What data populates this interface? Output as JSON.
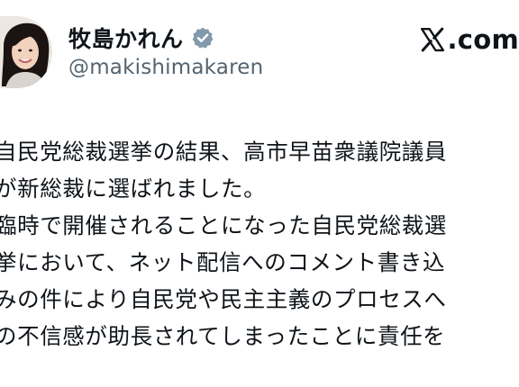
{
  "author": {
    "display_name": "牧島かれん",
    "handle": "@makishimakaren",
    "verified": true
  },
  "brand": {
    "text": ".com",
    "icon": "x-logo-icon"
  },
  "post": {
    "lines": [
      "自民党総裁選挙の結果、高市早苗衆議院議員",
      "が新総裁に選ばれました。",
      "臨時で開催されることになった自民党総裁選",
      "挙において、ネット配信へのコメント書き込",
      "みの件により自民党や民主主義のプロセスへ",
      "の不信感が助長されてしまったことに責任を"
    ]
  },
  "colors": {
    "text_primary": "#0f1419",
    "text_secondary": "#536471",
    "verified_badge": "#829aab"
  }
}
